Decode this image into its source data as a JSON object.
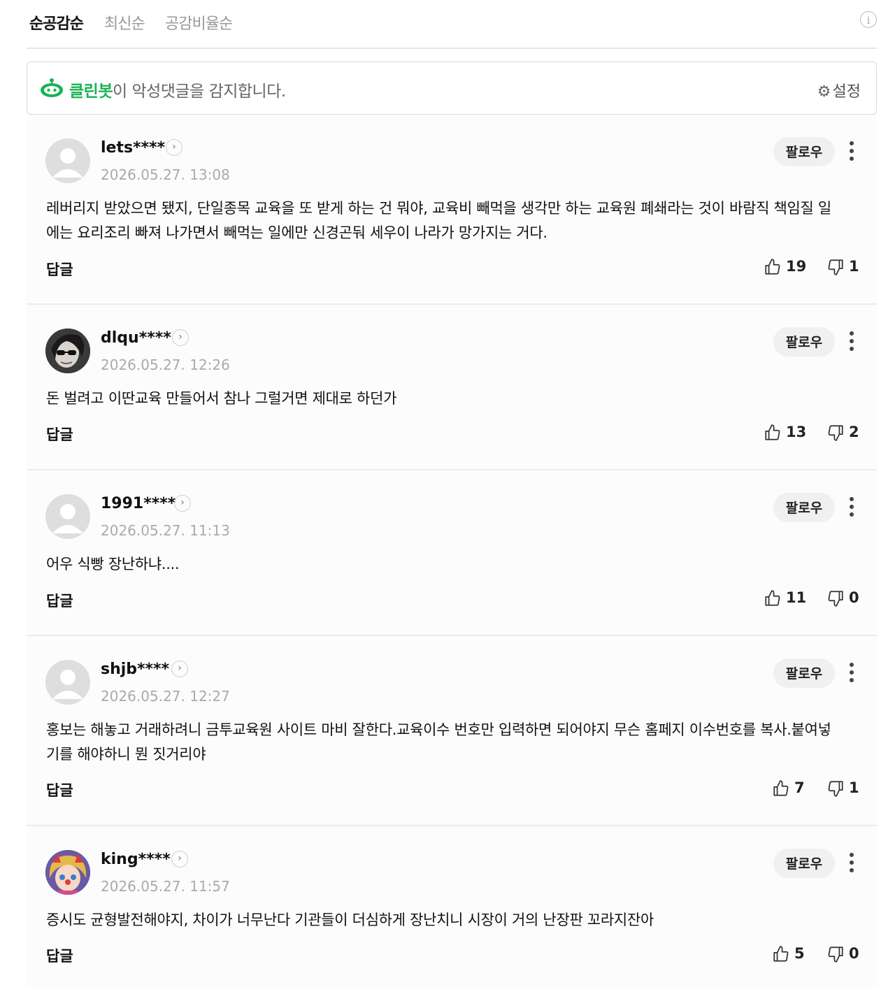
{
  "sort_tabs": [
    {
      "label": "순공감순",
      "active": true
    },
    {
      "label": "최신순",
      "active": false
    },
    {
      "label": "공감비율순",
      "active": false
    }
  ],
  "info_icon": "i",
  "cleanbot": {
    "brand": "클린봇",
    "message": "이 악성댓글을 감지합니다.",
    "settings_label": "설정",
    "brand_color": "#19b354"
  },
  "follow_label": "팔로우",
  "reply_label": "답글",
  "comments": [
    {
      "username": "lets****",
      "date": "2026.05.27. 13:08",
      "avatar": "default",
      "text": "레버리지 받았으면 됐지, 단일종목 교육을 또 받게 하는 건 뭐야, 교육비 빼먹을 생각만 하는 교육원 폐쇄라는 것이 바람직 책임질 일에는 요리조리 빠져 나가면서 빼먹는 일에만 신경곤둬 세우이 나라가 망가지는 거다.",
      "likes": "19",
      "dislikes": "1"
    },
    {
      "username": "dlqu****",
      "date": "2026.05.27. 12:26",
      "avatar": "photo-sunglasses",
      "text": "돈 벌려고 이딴교육 만들어서 참나 그럴거면 제대로 하던가",
      "likes": "13",
      "dislikes": "2"
    },
    {
      "username": "1991****",
      "date": "2026.05.27. 11:13",
      "avatar": "default",
      "text": "어우 식빵 장난하냐....",
      "likes": "11",
      "dislikes": "0"
    },
    {
      "username": "shjb****",
      "date": "2026.05.27. 12:27",
      "avatar": "default",
      "text": "홍보는 해놓고 거래하려니 금투교육원 사이트 마비 잘한다.교육이수 번호만 입력하면 되어야지 무슨 홈페지 이수번호를 복사.붙여넣기를 해야하니 뭔 짓거리야",
      "likes": "7",
      "dislikes": "1"
    },
    {
      "username": "king****",
      "date": "2026.05.27. 11:57",
      "avatar": "cartoon-character",
      "text": "증시도 균형발전해야지, 차이가 너무난다 기관들이 더심하게 장난치니 시장이 거의 난장판 꼬라지잔아",
      "likes": "5",
      "dislikes": "0"
    }
  ]
}
